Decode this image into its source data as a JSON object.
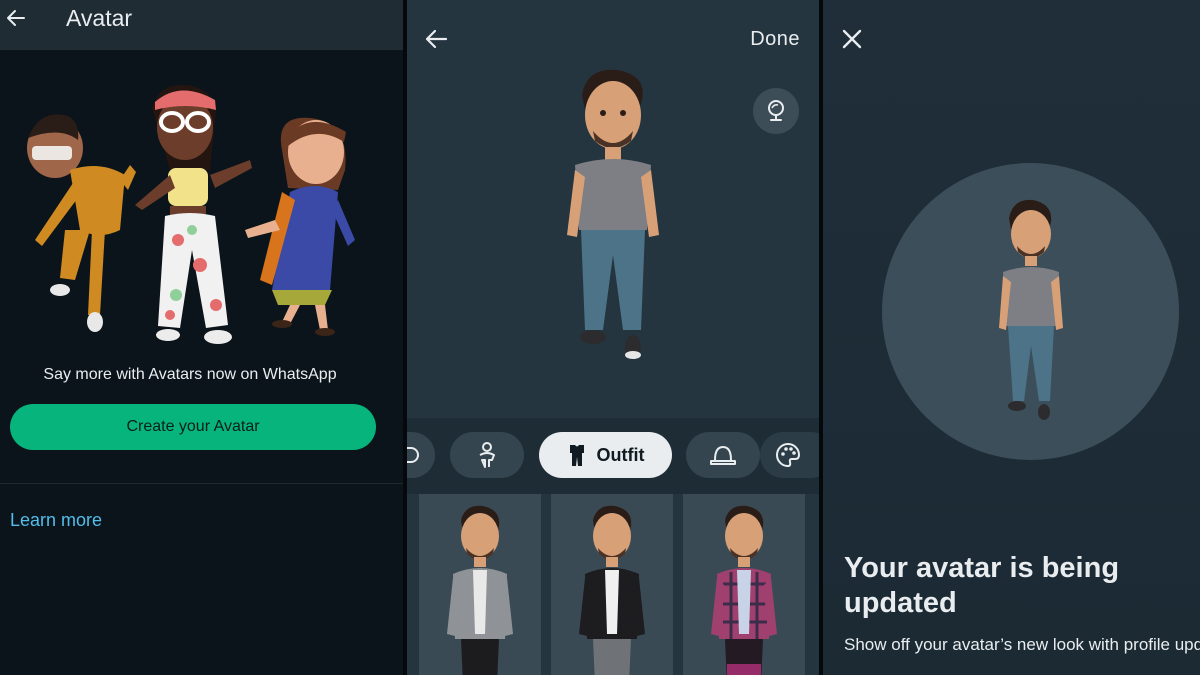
{
  "screen1": {
    "title": "Avatar",
    "tagline": "Say more with Avatars now on WhatsApp",
    "create_button": "Create your Avatar",
    "learn_more": "Learn more"
  },
  "screen2": {
    "done_label": "Done",
    "tabs": [
      {
        "icon": "body-icon"
      },
      {
        "icon": "outfit-icon",
        "label": "Outfit"
      },
      {
        "icon": "hat-icon"
      },
      {
        "icon": "palette-icon"
      }
    ],
    "outfit_items": [
      "grey-blazer-outfit",
      "black-jacket-outfit",
      "plaid-shirt-outfit"
    ]
  },
  "screen3": {
    "title": "Your avatar is being updated",
    "description": "Show off your avatar’s new look with profile updates and personalized stickers on"
  },
  "colors": {
    "accent_green": "#06b47c",
    "link_blue": "#53bdeb",
    "header_bg": "#1f2c34"
  }
}
